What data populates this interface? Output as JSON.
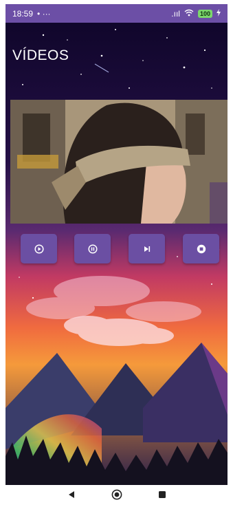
{
  "status_bar": {
    "time": "18:59",
    "left_extras": "• ···",
    "signal": ".ııl",
    "battery": "100"
  },
  "app": {
    "title": "VÍDEOS"
  },
  "controls": {
    "icons": [
      "play-circle-icon",
      "pause-circle-icon",
      "skip-next-icon",
      "stop-circle-icon"
    ]
  },
  "colors": {
    "button": "#6b4fa3",
    "status_bar": "#6c4fa6"
  }
}
